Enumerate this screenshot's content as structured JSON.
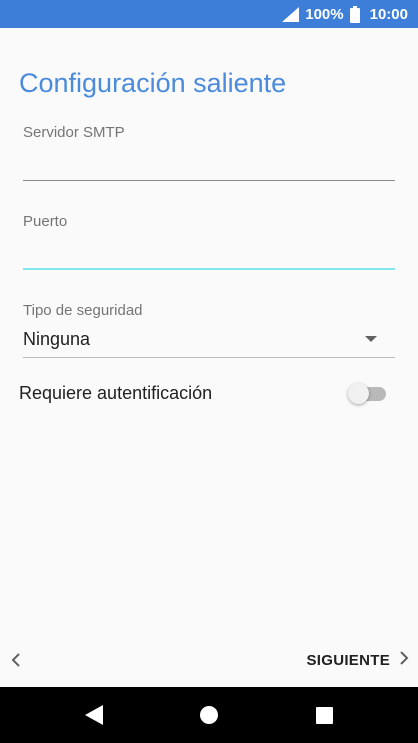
{
  "status_bar": {
    "battery_text": "100%",
    "time": "10:00",
    "icons": [
      "signal-icon",
      "battery-icon"
    ]
  },
  "page": {
    "title": "Configuración saliente"
  },
  "form": {
    "smtp_server": {
      "label": "Servidor SMTP",
      "value": ""
    },
    "port": {
      "label": "Puerto",
      "value": ""
    },
    "security_type": {
      "label": "Tipo de seguridad",
      "value": "Ninguna"
    },
    "requires_auth": {
      "label": "Requiere autentificación",
      "enabled": false
    }
  },
  "footer": {
    "next_label": "SIGUIENTE",
    "back_icon": "chevron-left-icon",
    "next_icon": "chevron-right-icon"
  },
  "nav_bar": {
    "icons": [
      "back-triangle-icon",
      "home-circle-icon",
      "recents-square-icon"
    ]
  },
  "colors": {
    "status_bar": "#3d7fd8",
    "title": "#4a8bdc",
    "focus_underline": "#80e8ec",
    "background": "#fafafa"
  }
}
